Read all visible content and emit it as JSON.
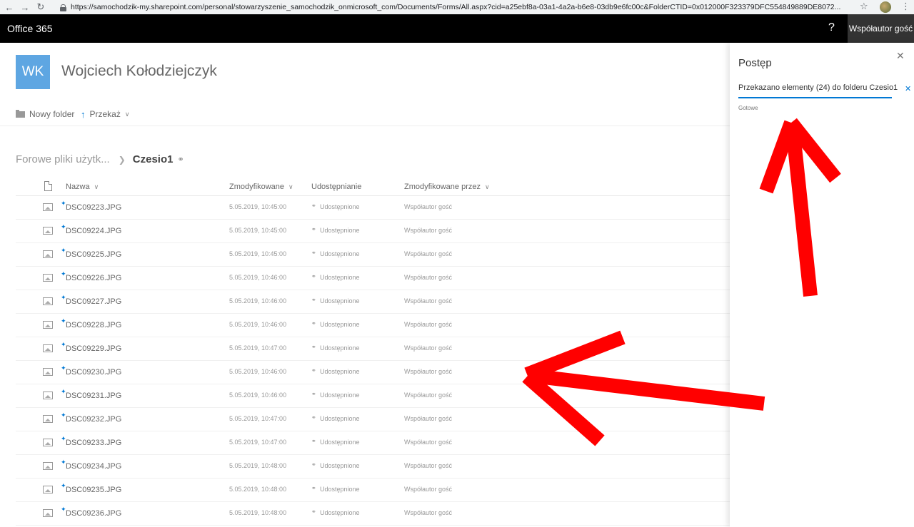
{
  "browser": {
    "url": "https://samochodzik-my.sharepoint.com/personal/stowarzyszenie_samochodzik_onmicrosoft_com/Documents/Forms/All.aspx?cid=a25ebf8a-03a1-4a2a-b6e8-03db9e6fc00c&FolderCTID=0x012000F323379DFC554849889DE8072..."
  },
  "suitebar": {
    "title": "Office 365",
    "help": "?",
    "user": "Współautor gość"
  },
  "site": {
    "logo": "WK",
    "name": "Wojciech Kołodziejczyk"
  },
  "commands": {
    "new_folder": "Nowy folder",
    "upload": "Przekaż"
  },
  "breadcrumb": {
    "parent": "Forowe pliki użytk...",
    "current": "Czesio1"
  },
  "columns": {
    "name": "Nazwa",
    "modified": "Zmodyfikowane",
    "sharing": "Udostępnianie",
    "modified_by": "Zmodyfikowane przez"
  },
  "files": [
    {
      "name": "DSC09223.JPG",
      "modified": "5.05.2019, 10:45:00",
      "sharing": "Udostępnione",
      "modified_by": "Współautor gość"
    },
    {
      "name": "DSC09224.JPG",
      "modified": "5.05.2019, 10:45:00",
      "sharing": "Udostępnione",
      "modified_by": "Współautor gość"
    },
    {
      "name": "DSC09225.JPG",
      "modified": "5.05.2019, 10:45:00",
      "sharing": "Udostępnione",
      "modified_by": "Współautor gość"
    },
    {
      "name": "DSC09226.JPG",
      "modified": "5.05.2019, 10:46:00",
      "sharing": "Udostępnione",
      "modified_by": "Współautor gość"
    },
    {
      "name": "DSC09227.JPG",
      "modified": "5.05.2019, 10:46:00",
      "sharing": "Udostępnione",
      "modified_by": "Współautor gość"
    },
    {
      "name": "DSC09228.JPG",
      "modified": "5.05.2019, 10:46:00",
      "sharing": "Udostępnione",
      "modified_by": "Współautor gość"
    },
    {
      "name": "DSC09229.JPG",
      "modified": "5.05.2019, 10:47:00",
      "sharing": "Udostępnione",
      "modified_by": "Współautor gość"
    },
    {
      "name": "DSC09230.JPG",
      "modified": "5.05.2019, 10:46:00",
      "sharing": "Udostępnione",
      "modified_by": "Współautor gość"
    },
    {
      "name": "DSC09231.JPG",
      "modified": "5.05.2019, 10:46:00",
      "sharing": "Udostępnione",
      "modified_by": "Współautor gość"
    },
    {
      "name": "DSC09232.JPG",
      "modified": "5.05.2019, 10:47:00",
      "sharing": "Udostępnione",
      "modified_by": "Współautor gość"
    },
    {
      "name": "DSC09233.JPG",
      "modified": "5.05.2019, 10:47:00",
      "sharing": "Udostępnione",
      "modified_by": "Współautor gość"
    },
    {
      "name": "DSC09234.JPG",
      "modified": "5.05.2019, 10:48:00",
      "sharing": "Udostępnione",
      "modified_by": "Współautor gość"
    },
    {
      "name": "DSC09235.JPG",
      "modified": "5.05.2019, 10:48:00",
      "sharing": "Udostępnione",
      "modified_by": "Współautor gość"
    },
    {
      "name": "DSC09236.JPG",
      "modified": "5.05.2019, 10:48:00",
      "sharing": "Udostępnione",
      "modified_by": "Współautor gość"
    }
  ],
  "progress_panel": {
    "title": "Postęp",
    "message": "Przekazano elementy (24) do folderu Czesio1",
    "status": "Gotowe"
  },
  "colors": {
    "suitebar": "#000000",
    "accent": "#0078d4",
    "logo_bg": "#5ea6e2",
    "annotation": "#ff0000"
  }
}
